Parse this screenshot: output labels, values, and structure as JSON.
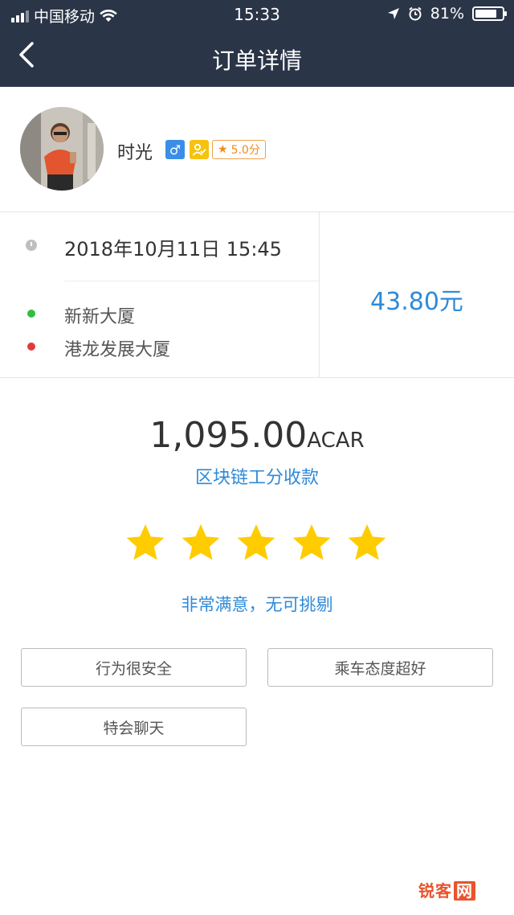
{
  "status_bar": {
    "carrier": "中国移动",
    "time": "15:33",
    "battery": "81%",
    "battery_level": 0.81
  },
  "nav": {
    "title": "订单详情"
  },
  "driver": {
    "name": "时光",
    "gender_symbol": "♂",
    "rating": "5.0分"
  },
  "trip": {
    "time": "2018年10月11日 15:45",
    "from": "新新大厦",
    "to": "港龙发展大厦",
    "price": "43.80元"
  },
  "payment": {
    "amount": "1,095.00",
    "unit": "ACAR",
    "label": "区块链工分收款"
  },
  "review": {
    "stars": 5,
    "max_stars": 5,
    "comment": "非常满意，无可挑剔",
    "tags": [
      "行为很安全",
      "乘车态度超好",
      "特会聊天"
    ]
  },
  "watermark": {
    "text": "锐客",
    "badge": "网"
  },
  "colors": {
    "header_bg": "#2b3548",
    "accent_blue": "#2f8ad8",
    "star_yellow": "#ffcc00",
    "badge_orange": "#f08a1e"
  }
}
